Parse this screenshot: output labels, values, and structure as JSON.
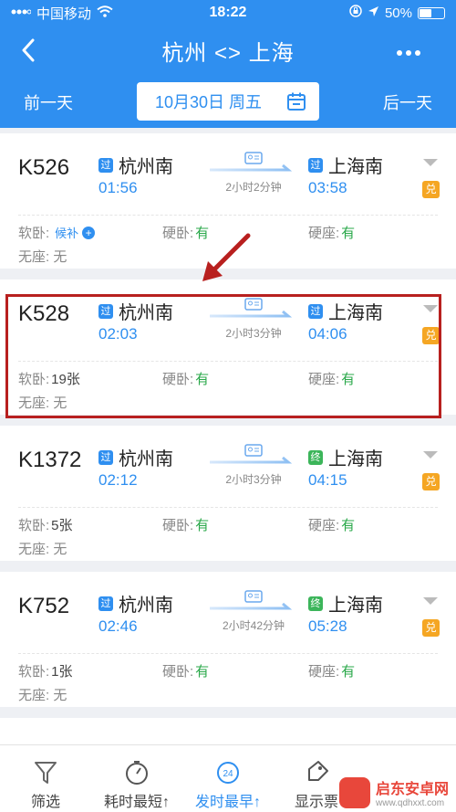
{
  "status_bar": {
    "carrier": "中国移动",
    "time": "18:22",
    "battery": "50%",
    "battery_level": 0.5
  },
  "nav": {
    "title": "杭州 <> 上海"
  },
  "date_bar": {
    "prev": "前一天",
    "date": "10月30日 周五",
    "next": "后一天"
  },
  "trains": [
    {
      "no": "K526",
      "dep_station": "杭州南",
      "dep_badge": "过",
      "dep_time": "01:56",
      "arr_station": "上海南",
      "arr_badge": "过",
      "arr_time": "03:58",
      "duration": "2小时2分钟",
      "redeem": "兑",
      "soft_label": "软卧:",
      "soft_value": "候补",
      "hard_sleeper_label": "硬卧:",
      "hard_sleeper_value": "有",
      "hard_seat_label": "硬座:",
      "hard_seat_value": "有",
      "no_seat_label": "无座:",
      "no_seat_value": "无"
    },
    {
      "no": "K528",
      "dep_station": "杭州南",
      "dep_badge": "过",
      "dep_time": "02:03",
      "arr_station": "上海南",
      "arr_badge": "过",
      "arr_time": "04:06",
      "duration": "2小时3分钟",
      "redeem": "兑",
      "soft_label": "软卧:",
      "soft_value": "19张",
      "hard_sleeper_label": "硬卧:",
      "hard_sleeper_value": "有",
      "hard_seat_label": "硬座:",
      "hard_seat_value": "有",
      "no_seat_label": "无座:",
      "no_seat_value": "无"
    },
    {
      "no": "K1372",
      "dep_station": "杭州南",
      "dep_badge": "过",
      "dep_time": "02:12",
      "arr_station": "上海南",
      "arr_badge": "终",
      "arr_time": "04:15",
      "duration": "2小时3分钟",
      "redeem": "兑",
      "soft_label": "软卧:",
      "soft_value": "5张",
      "hard_sleeper_label": "硬卧:",
      "hard_sleeper_value": "有",
      "hard_seat_label": "硬座:",
      "hard_seat_value": "有",
      "no_seat_label": "无座:",
      "no_seat_value": "无"
    },
    {
      "no": "K752",
      "dep_station": "杭州南",
      "dep_badge": "过",
      "dep_time": "02:46",
      "arr_station": "上海南",
      "arr_badge": "终",
      "arr_time": "05:28",
      "duration": "2小时42分钟",
      "redeem": "兑",
      "soft_label": "软卧:",
      "soft_value": "1张",
      "hard_sleeper_label": "硬卧:",
      "hard_sleeper_value": "有",
      "hard_seat_label": "硬座:",
      "hard_seat_value": "有",
      "no_seat_label": "无座:",
      "no_seat_value": "无"
    }
  ],
  "bottom_tabs": [
    {
      "label": "筛选",
      "icon": "filter-icon"
    },
    {
      "label": "耗时最短↑",
      "icon": "stopwatch-icon"
    },
    {
      "label": "发时最早↑",
      "icon": "clock-24-icon",
      "badge": "24"
    },
    {
      "label": "显示票",
      "icon": "ticket-icon"
    }
  ],
  "watermark": {
    "title": "启东安卓网",
    "subtitle": "www.qdhxxt.com"
  },
  "colors": {
    "primary": "#2f8ff0",
    "available": "#2aa84a",
    "redeem": "#f5a623",
    "highlight": "#b8201f"
  }
}
